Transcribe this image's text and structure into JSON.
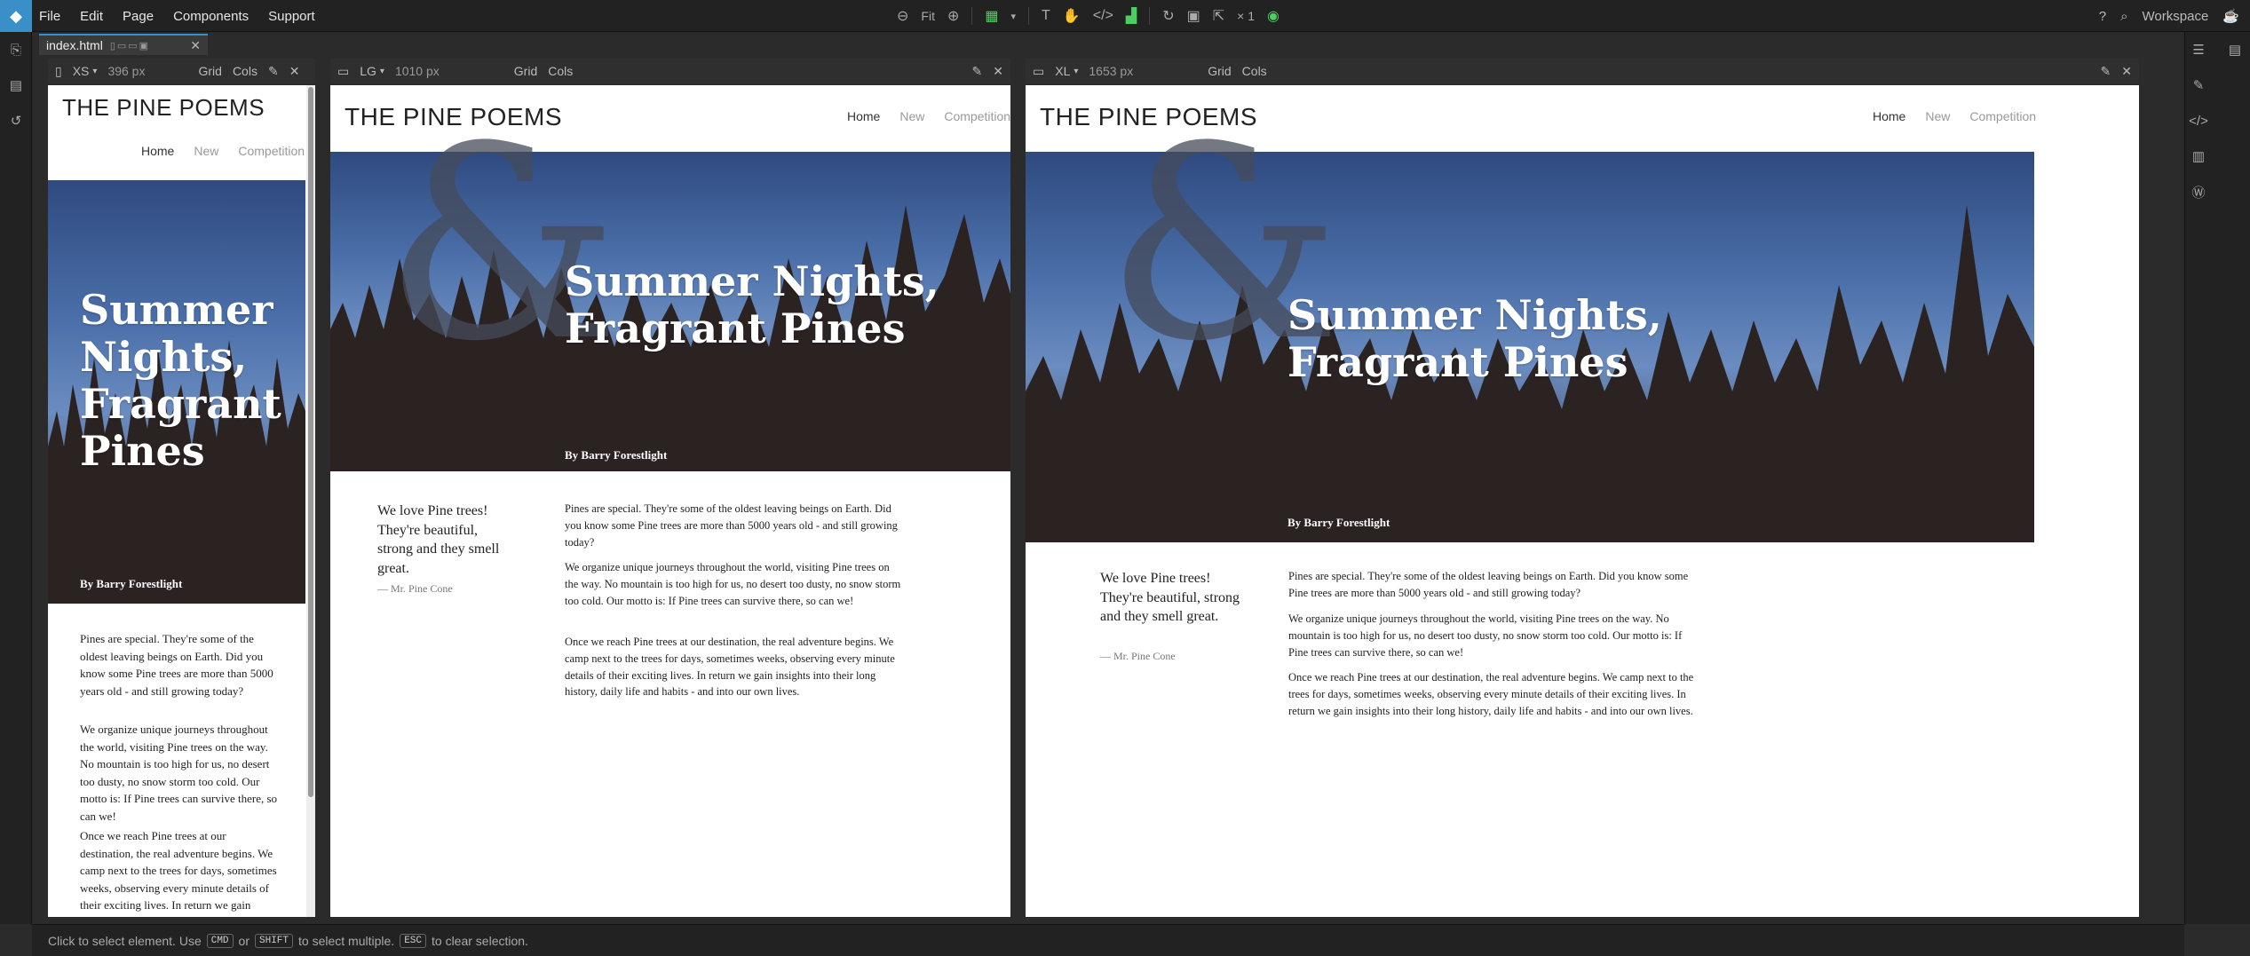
{
  "menubar": {
    "items": [
      "File",
      "Edit",
      "Page",
      "Components",
      "Support"
    ],
    "fit_label": "Fit",
    "multiplier": "× 1",
    "workspace": "Workspace"
  },
  "tab": {
    "filename": "index.html"
  },
  "views": [
    {
      "icon": "phone-icon",
      "size": "XS",
      "width": "396 px",
      "grid": "Grid",
      "cols": "Cols"
    },
    {
      "icon": "laptop-icon",
      "size": "LG",
      "width": "1010 px",
      "grid": "Grid",
      "cols": "Cols"
    },
    {
      "icon": "desktop-icon",
      "size": "XL",
      "width": "1653 px",
      "grid": "Grid",
      "cols": "Cols"
    }
  ],
  "site": {
    "title": "THE PINE POEMS",
    "nav": [
      "Home",
      "New",
      "Competition"
    ],
    "ampersand": "&",
    "hero_title": "Summer Nights, Fragrant Pines",
    "hero_title_lines": [
      "Summer",
      "Nights,",
      "Fragrant",
      "Pines"
    ],
    "hero_title_two_lines": [
      "Summer Nights,",
      "Fragrant Pines"
    ],
    "byline": "By Barry Forestlight",
    "quote": "We love Pine trees! They're beautiful, strong and they smell great.",
    "quote_author": "— Mr. Pine Cone",
    "paragraphs": [
      "Pines are special. They're some of the oldest leaving beings on Earth. Did you know some Pine trees are more than 5000 years old - and still growing today?",
      "We organize unique journeys throughout the world, visiting Pine trees on the way. No mountain is too high for us, no desert too dusty, no snow storm too cold. Our motto is: If Pine trees can survive there, so can we!",
      "Once we reach Pine trees at our destination, the real adventure begins. We camp next to the trees for days, sometimes weeks, observing every minute details of their exciting lives. In return we gain insights into their long history, daily life and habits - and into our own lives."
    ],
    "xs_partial_line": "return we gain insights into their long"
  },
  "status": {
    "p1": "Click to select element. Use",
    "k1": "CMD",
    "p2": "or",
    "k2": "SHIFT",
    "p3": "to select multiple.",
    "k3": "ESC",
    "p4": "to clear selection."
  }
}
